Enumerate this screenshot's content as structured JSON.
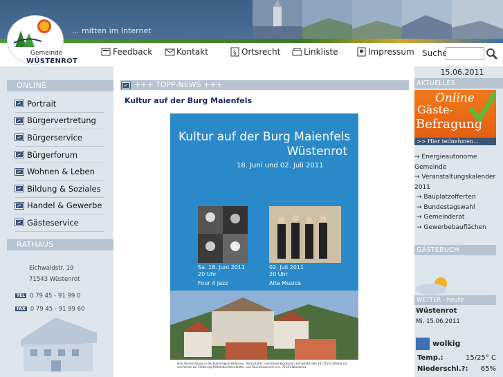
{
  "header": {
    "tagline": "... mitten im Internet",
    "logo_gemeinde": "Gemeinde",
    "logo_name": "WÜSTENROT"
  },
  "topnav": {
    "items": [
      {
        "label": "Feedback",
        "icon": "feedback-icon"
      },
      {
        "label": "Kontakt",
        "icon": "mail-icon"
      },
      {
        "label": "Ortsrecht",
        "icon": "law-icon"
      },
      {
        "label": "Linkliste",
        "icon": "link-icon"
      },
      {
        "label": "Impressum",
        "icon": "impressum-icon"
      }
    ],
    "search_label": "Suche",
    "search_value": ""
  },
  "left": {
    "online_head": "ONLINE",
    "menu": [
      "Portrait",
      "Bürgervertretung",
      "Bürgerservice",
      "Bürgerforum",
      "Wohnen & Leben",
      "Bildung & Soziales",
      "Handel & Gewerbe",
      "Gästeservice"
    ],
    "rathaus_head": "RATHAUS",
    "address_street": "Eichwaldstr. 19",
    "address_city": "71543 Wüstenrot",
    "tel_tag": "TEL",
    "tel": "0 79 45 - 91 99 0",
    "fax_tag": "FAX",
    "fax": "0 79 45 - 91 99 60"
  },
  "main": {
    "news_head": "+++ TOPP-NEWS +++",
    "news_title": "Kultur auf der Burg Maienfels",
    "poster": {
      "title_l1": "Kultur auf der Burg Maienfels",
      "title_l2": "Wüstenrot",
      "dates": "18. Juni und 02. Juli 2011",
      "ev1_date": "Sa. 18. Juni 2011",
      "ev1_time": "20 Uhr",
      "ev1_name": "Four 4 Jazz",
      "ev2_date": "02. Juli 2011",
      "ev2_time": "20 Uhr",
      "ev2_name": "Alta Musica",
      "footer": "Eine Veranstaltung in der Kulturregion Heilbronn. Veranstalter: Gemeinde Wüstenrot, Eichwaldstraße 19, 71543 Wüstenrot und Verein zur Förderung Mittelalterlicher Kultur- und Tourismusverein e.V., 71543 Wüstenrot"
    }
  },
  "right": {
    "date": "15.06.2011",
    "aktuelles_head": "AKTUELLES",
    "survey_online": "Online",
    "survey_gaeste": "Gäste-",
    "survey_befragung": "Befragung",
    "survey_bar": ">> Hier teilnehmen...",
    "links": [
      "→ Energieautonome Gemeinde",
      "→ Veranstaltungskalender 2011",
      "→ Bauplatzofferten",
      "→ Bundestagswahl",
      "→ Gemeinderat",
      "→ Gewerbebauflächen"
    ],
    "gaestebuch_head": "GÄSTEBUCH",
    "weather_head": "WETTER - heute",
    "weather_city": "Wüstenrot",
    "weather_date": "Mi. 15.06.2011",
    "weather_cond": "wolkig",
    "temp_label": "Temp.:",
    "temp_value": "15/25° C",
    "rain_label": "Niederschl.?:",
    "rain_value": "65%"
  },
  "colors": {
    "header_blue": "#4b6f98",
    "section_head": "#b7c3d1",
    "sidebar_bg": "#dfe5ec",
    "title_blue": "#1a2a66",
    "poster_blue": "#2a89c8",
    "survey_orange": "#f07a1c"
  }
}
